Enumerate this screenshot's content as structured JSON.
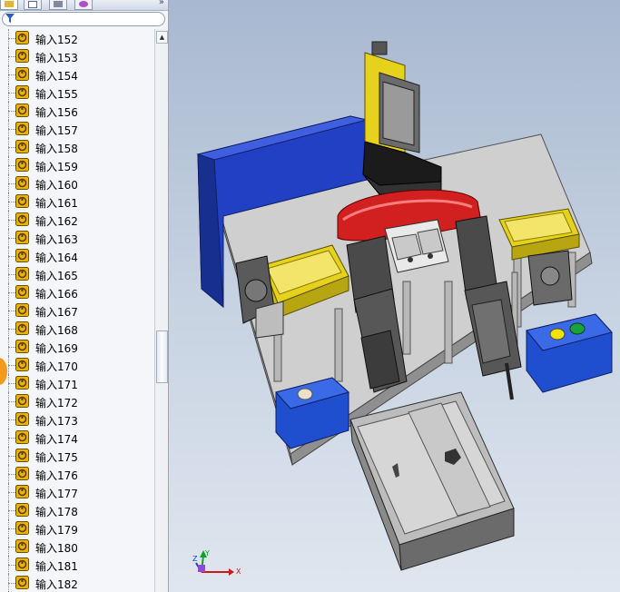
{
  "panel": {
    "tabs": [
      "feature-manager",
      "property-manager",
      "configuration-manager",
      "display-manager"
    ],
    "more_label": "»",
    "filter": {
      "placeholder": ""
    }
  },
  "tree": {
    "items": [
      {
        "label": "输入152"
      },
      {
        "label": "输入153"
      },
      {
        "label": "输入154"
      },
      {
        "label": "输入155"
      },
      {
        "label": "输入156"
      },
      {
        "label": "输入157"
      },
      {
        "label": "输入158"
      },
      {
        "label": "输入159"
      },
      {
        "label": "输入160"
      },
      {
        "label": "输入161"
      },
      {
        "label": "输入162"
      },
      {
        "label": "输入163"
      },
      {
        "label": "输入164"
      },
      {
        "label": "输入165"
      },
      {
        "label": "输入166"
      },
      {
        "label": "输入167"
      },
      {
        "label": "输入168"
      },
      {
        "label": "输入169"
      },
      {
        "label": "输入170"
      },
      {
        "label": "输入171"
      },
      {
        "label": "输入172"
      },
      {
        "label": "输入173"
      },
      {
        "label": "输入174"
      },
      {
        "label": "输入175"
      },
      {
        "label": "输入176"
      },
      {
        "label": "输入177"
      },
      {
        "label": "输入178"
      },
      {
        "label": "输入179"
      },
      {
        "label": "输入180"
      },
      {
        "label": "输入181"
      },
      {
        "label": "输入182"
      }
    ],
    "item_icon": "part-input-icon"
  },
  "triad": {
    "x_label": "X",
    "y_label": "Y",
    "z_label": "Z"
  },
  "colors": {
    "viewport_top": "#a8b8d0",
    "base_plate": "#c8c8c8",
    "blue_box": "#1f3fbf",
    "yellow_tray": "#e6d21c",
    "red_cover": "#d01c1c",
    "icon_yellow": "#e8b400"
  }
}
